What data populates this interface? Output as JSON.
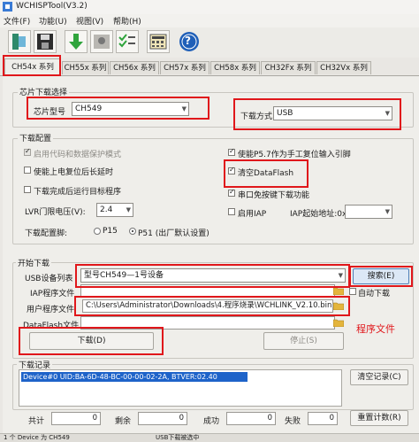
{
  "window": {
    "title": "WCHISPTool(V3.2)"
  },
  "menu": [
    "文件(F)",
    "功能(U)",
    "视图(V)",
    "帮助(H)"
  ],
  "toolbar": {
    "icons": [
      "open-icon",
      "save-icon",
      "download-icon",
      "image-icon",
      "list-check-icon",
      "calculator-icon",
      "help-icon"
    ],
    "help_glyph": "?"
  },
  "tabs": [
    "CH54x 系列",
    "CH55x 系列",
    "CH56x 系列",
    "CH57x 系列",
    "CH58x 系列",
    "CH32Fx 系列",
    "CH32Vx 系列"
  ],
  "chip_select": {
    "group_title": "芯片下载选择",
    "model_label": "芯片型号",
    "model_value": "CH549",
    "mode_label": "下载方式",
    "mode_value": "USB"
  },
  "config": {
    "group_title": "下载配置",
    "enable_code_protect": "启用代码和数据保护模式",
    "enable_power_reset": "使能上电复位后长延时",
    "run_after_download": "下载完成后运行目标程序",
    "lvr_label": "LVR门限电压(V):",
    "lvr_value": "2.4",
    "pin_label": "下载配置脚:",
    "radio_p15": "P15",
    "radio_p51": "P51 (出厂默认设置)",
    "p57_reset": "使能P5.7作为手工复位输入引脚",
    "clear_dataflash": "清空DataFlash",
    "serial_no_key": "串口免按键下载功能",
    "enable_iap": "启用IAP",
    "iap_addr_label": "IAP起始地址:0x",
    "iap_addr_value": ""
  },
  "start": {
    "group_title": "开始下载",
    "usb_list_label": "USB设备列表",
    "usb_list_value": "型号CH549—1号设备",
    "search_button": "搜索(E)",
    "iap_file_label": "IAP程序文件",
    "iap_file_value": "",
    "auto_download": "自动下载",
    "user_file_label": "用户程序文件",
    "user_file_value": "C:\\Users\\Administrator\\Downloads\\4.程序烧录\\WCHLINK_V2.10.bin",
    "dataflash_label": "DataFlash文件",
    "dataflash_value": "",
    "download_button": "下载(D)",
    "stop_button": "停止(S)",
    "annotation": "程序文件"
  },
  "log": {
    "group_title": "下载记录",
    "entries": [
      "Device#0 UID:BA-6D-48-BC-00-00-02-2A, BTVER:02.40"
    ],
    "clear_button": "清空记录(C)"
  },
  "stats": {
    "total_label": "共计",
    "total_value": "0",
    "remain_label": "剩余",
    "remain_value": "0",
    "success_label": "成功",
    "success_value": "0",
    "fail_label": "失败",
    "fail_value": "0",
    "reset_button": "重置计数(R)"
  },
  "status": {
    "left": "1 个 Device 为 CH549",
    "middle": "USB下载被选中"
  },
  "colors": {
    "annotation_red": "#e0171b",
    "selection_blue": "#1e63c9",
    "accent_blue": "#4f7fb8"
  }
}
